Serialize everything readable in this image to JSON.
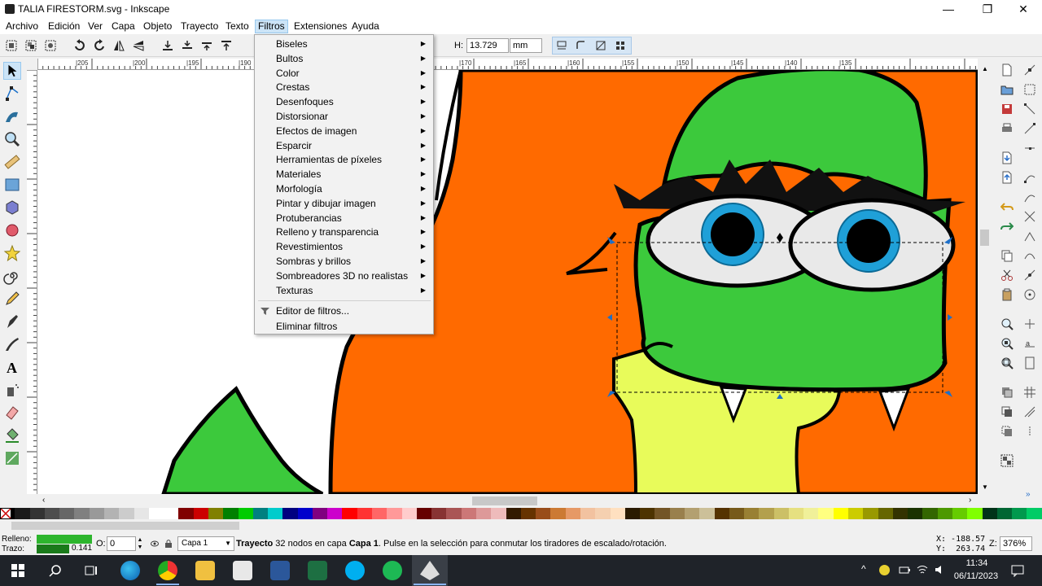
{
  "window": {
    "title": "TALIA FIRESTORM.svg - Inkscape",
    "controls": [
      "—",
      "❐",
      "✕"
    ]
  },
  "menubar": {
    "items": [
      "Archivo",
      "Edición",
      "Ver",
      "Capa",
      "Objeto",
      "Trayecto",
      "Texto",
      "Filtros",
      "Extensiones",
      "Ayuda"
    ]
  },
  "toolbar": {
    "h_label": "H:",
    "h_value": "13.729",
    "unit": "mm"
  },
  "filters_menu": {
    "items": [
      {
        "label": "Biseles",
        "submenu": true
      },
      {
        "label": "Bultos",
        "submenu": true
      },
      {
        "label": "Color",
        "submenu": true
      },
      {
        "label": "Crestas",
        "submenu": true
      },
      {
        "label": "Desenfoques",
        "submenu": true
      },
      {
        "label": "Distorsionar",
        "submenu": true
      },
      {
        "label": "Efectos de imagen",
        "submenu": true
      },
      {
        "label": "Esparcir",
        "submenu": true
      },
      {
        "label": "Herramientas de píxeles",
        "submenu": true
      },
      {
        "label": "Materiales",
        "submenu": true
      },
      {
        "label": "Morfología",
        "submenu": true
      },
      {
        "label": "Pintar y dibujar imagen",
        "submenu": true
      },
      {
        "label": "Protuberancias",
        "submenu": true
      },
      {
        "label": "Relleno y transparencia",
        "submenu": true
      },
      {
        "label": "Revestimientos",
        "submenu": true
      },
      {
        "label": "Sombras y brillos",
        "submenu": true
      },
      {
        "label": "Sombreadores 3D no realistas",
        "submenu": true
      },
      {
        "label": "Texturas",
        "submenu": true
      }
    ],
    "editor": "Editor de filtros...",
    "remove": "Eliminar filtros",
    "submenu_arrow": "▶"
  },
  "ruler": {
    "h_labels": [
      "|205",
      "|200",
      "|195",
      "|190",
      "|170",
      "|165",
      "|160",
      "|155",
      "|150",
      "|145",
      "|140",
      "|135"
    ]
  },
  "status": {
    "fill_label": "Relleno:",
    "stroke_label": "Trazo:",
    "stroke_value": "0.141",
    "opacity_label": "O:",
    "opacity_value": "0",
    "layer": "Capa 1",
    "message_bold": "Trayecto",
    "message_pre": " 32 nodos en capa ",
    "message_layer": "Capa 1",
    "message_post": ". Pulse en la selección para conmutar los tiradores de escalado/rotación.",
    "x_coord": "X: -188.57",
    "y_coord": "Y:  263.74",
    "zoom_label": "Z:",
    "zoom_value": "376%"
  },
  "taskbar": {
    "time": "11:34",
    "date": "06/11/2023"
  },
  "colors": {
    "fill": "#2db52d",
    "orange": "#ff6a00",
    "green": "#3cc93c",
    "yellow": "#e8fb5a"
  }
}
